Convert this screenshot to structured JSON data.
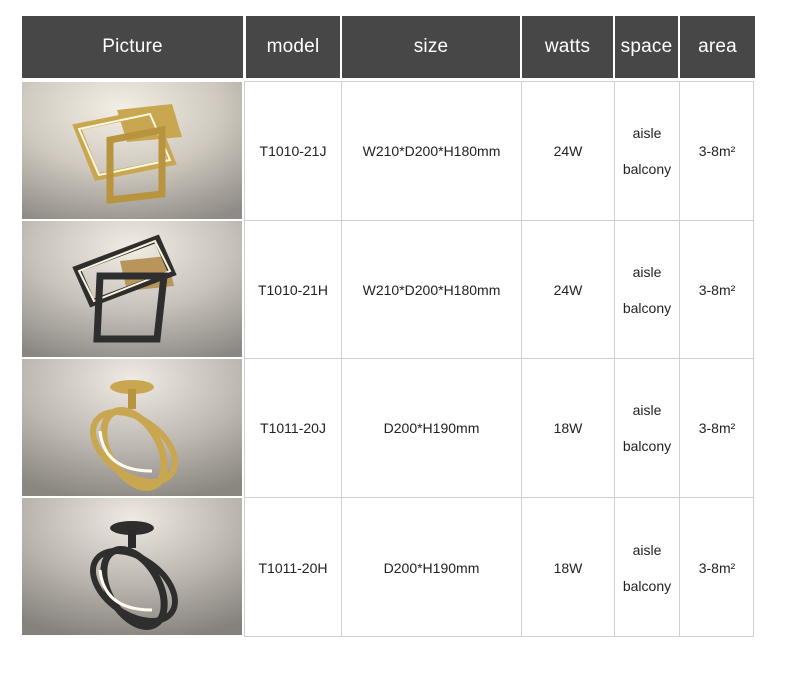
{
  "header": {
    "picture": "Picture",
    "model": "model",
    "size": "size",
    "watts": "watts",
    "space": "space",
    "area": "area"
  },
  "rows": [
    {
      "model": "T1010-21J",
      "size": "W210*D200*H180mm",
      "watts": "24W",
      "space_line1": "aisle",
      "space_line2": "balcony",
      "area": "3-8m²",
      "image": "gold-square-ceiling-lamp"
    },
    {
      "model": "T1010-21H",
      "size": "W210*D200*H180mm",
      "watts": "24W",
      "space_line1": "aisle",
      "space_line2": "balcony",
      "area": "3-8m²",
      "image": "black-square-ceiling-lamp"
    },
    {
      "model": "T1011-20J",
      "size": "D200*H190mm",
      "watts": "18W",
      "space_line1": "aisle",
      "space_line2": "balcony",
      "area": "3-8m²",
      "image": "gold-ring-ceiling-lamp"
    },
    {
      "model": "T1011-20H",
      "size": "D200*H190mm",
      "watts": "18W",
      "space_line1": "aisle",
      "space_line2": "balcony",
      "area": "3-8m²",
      "image": "black-ring-ceiling-lamp"
    }
  ],
  "colors": {
    "header_bg": "#474747",
    "gold": "#c9a650",
    "black": "#2e2e2e",
    "border": "#d0d0d0"
  }
}
